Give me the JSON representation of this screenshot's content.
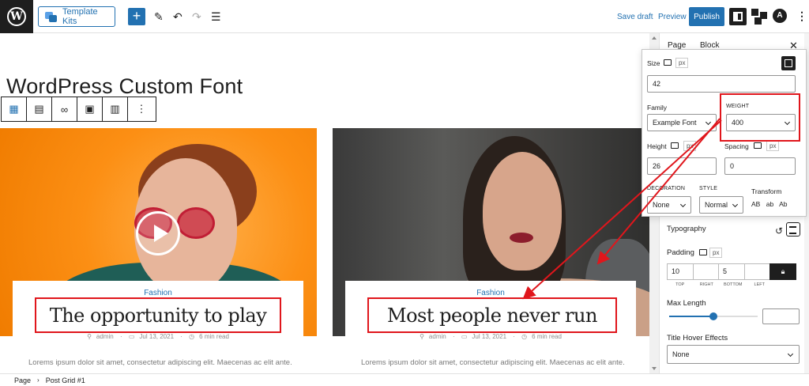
{
  "toolbar": {
    "template_kits_label": "Template Kits",
    "add_label": "+",
    "save_draft_label": "Save draft",
    "preview_label": "Preview",
    "publish_label": "Publish"
  },
  "post": {
    "title": "WordPress Custom Font"
  },
  "cards": [
    {
      "category": "Fashion",
      "title": "The opportunity to play",
      "author": "admin",
      "date": "Jul 13, 2021",
      "read_time": "6 min read",
      "excerpt": "Lorems ipsum dolor sit amet, consectetur adipiscing elit. Maecenas ac elit ante."
    },
    {
      "category": "Fashion",
      "title": "Most people never run",
      "author": "admin",
      "date": "Jul 13, 2021",
      "read_time": "6 min read",
      "excerpt": "Lorems ipsum dolor sit amet, consectetur adipiscing elit. Maecenas ac elit ante."
    }
  ],
  "sidebar": {
    "tab_page": "Page",
    "tab_block": "Block",
    "typography_label": "Typography",
    "padding_label": "Padding",
    "padding_unit": "px",
    "padding_values": [
      "10",
      "",
      "5",
      ""
    ],
    "padding_sides": [
      "TOP",
      "RIGHT",
      "BOTTOM",
      "LEFT"
    ],
    "max_length_label": "Max Length",
    "max_length_value": 0.5,
    "hover_effects_label": "Title Hover Effects",
    "hover_effects_value": "None"
  },
  "typography_popover": {
    "size_label": "Size",
    "size_unit": "px",
    "size_value": "42",
    "family_label": "Family",
    "family_value": "Example Font",
    "weight_label": "WEIGHT",
    "weight_value": "400",
    "height_label": "Height",
    "height_unit": "px",
    "height_value": "26",
    "spacing_label": "Spacing",
    "spacing_unit": "px",
    "spacing_value": "0",
    "decoration_label": "DECORATION",
    "decoration_value": "None",
    "style_label": "STYLE",
    "style_value": "Normal",
    "transform_label": "Transform",
    "transform_options": [
      "AB",
      "ab",
      "Ab"
    ]
  },
  "footer": {
    "crumb_root": "Page",
    "crumb_current": "Post Grid #1"
  },
  "colors": {
    "accent": "#2271b1",
    "highlight": "#e0161c"
  }
}
